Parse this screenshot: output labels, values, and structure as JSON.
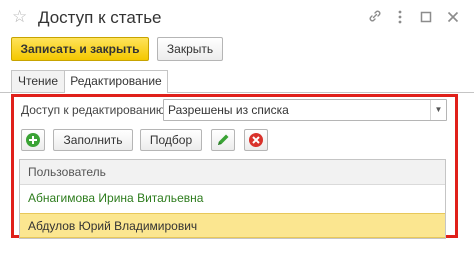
{
  "window": {
    "title": "Доступ к статье",
    "icons": [
      "star-icon",
      "link-icon",
      "more-icon",
      "maximize-icon",
      "close-icon"
    ]
  },
  "toolbar": {
    "save_close_label": "Записать и закрыть",
    "close_label": "Закрыть"
  },
  "tabs": [
    {
      "label": "Чтение",
      "active": false
    },
    {
      "label": "Редактирование",
      "active": true
    }
  ],
  "edit_access": {
    "label": "Доступ к редактированию:",
    "value": "Разрешены из списка"
  },
  "list_toolbar": {
    "add_icon": "add-icon",
    "fill_label": "Заполнить",
    "pick_label": "Подбор",
    "edit_icon": "pencil-icon",
    "delete_icon": "delete-icon"
  },
  "table": {
    "column_header": "Пользователь",
    "rows": [
      {
        "user": "Абнагимова Ирина Витальевна",
        "selected": false
      },
      {
        "user": "Абдулов Юрий Владимирович",
        "selected": true
      }
    ]
  },
  "colors": {
    "primary_button": "#f4c800",
    "highlight_border": "#e0201a",
    "selected_row": "#fbe690",
    "green_text": "#2e7d1e"
  }
}
